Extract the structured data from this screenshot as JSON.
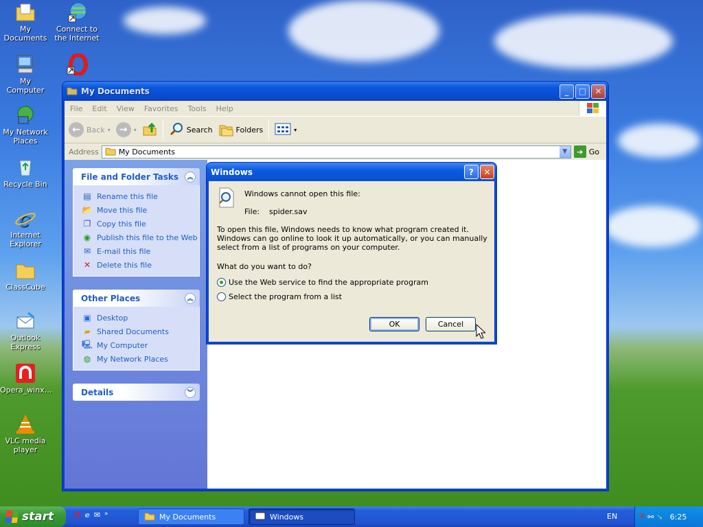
{
  "desktop": {
    "icons": [
      {
        "label": "My Documents",
        "icon": "folder-docs-icon"
      },
      {
        "label": "Connect to the Internet",
        "icon": "globe-shortcut-icon"
      },
      {
        "label": "My Computer",
        "icon": "computer-icon"
      },
      {
        "label": "My Network Places",
        "icon": "network-icon"
      },
      {
        "label": "Recycle Bin",
        "icon": "recycle-bin-icon"
      },
      {
        "label": "Internet Explorer",
        "icon": "ie-icon"
      },
      {
        "label": "ClassCube",
        "icon": "folder-icon"
      },
      {
        "label": "Outlook Express",
        "icon": "outlook-icon"
      },
      {
        "label": "Opera_winx…",
        "icon": "opera-installer-icon"
      },
      {
        "label": "VLC media player",
        "icon": "vlc-icon"
      },
      {
        "label": "",
        "icon": "opera-icon"
      }
    ]
  },
  "window": {
    "title": "My Documents",
    "menu": [
      "File",
      "Edit",
      "View",
      "Favorites",
      "Tools",
      "Help"
    ],
    "toolbar": {
      "back": "Back",
      "search": "Search",
      "folders": "Folders"
    },
    "address": {
      "label": "Address",
      "value": "My Documents",
      "go": "Go"
    },
    "tasks": {
      "title": "File and Folder Tasks",
      "items": [
        "Rename this file",
        "Move this file",
        "Copy this file",
        "Publish this file to the Web",
        "E-mail this file",
        "Delete this file"
      ]
    },
    "other_places": {
      "title": "Other Places",
      "items": [
        "Desktop",
        "Shared Documents",
        "My Computer",
        "My Network Places"
      ]
    },
    "details": {
      "title": "Details"
    }
  },
  "dialog": {
    "title": "Windows",
    "message": "Windows cannot open this file:",
    "file_label": "File:",
    "file_name": "spider.sav",
    "explanation": "To open this file, Windows needs to know what program created it.  Windows can go online to look it up automatically, or you can manually select from a list of programs on your computer.",
    "question": "What do you want to do?",
    "options": [
      "Use the Web service to find the appropriate program",
      "Select the program from a list"
    ],
    "selected_option": 0,
    "ok": "OK",
    "cancel": "Cancel"
  },
  "taskbar": {
    "start": "start",
    "tasks": [
      "My Documents",
      "Windows"
    ],
    "language": "EN",
    "clock": "6:25"
  }
}
